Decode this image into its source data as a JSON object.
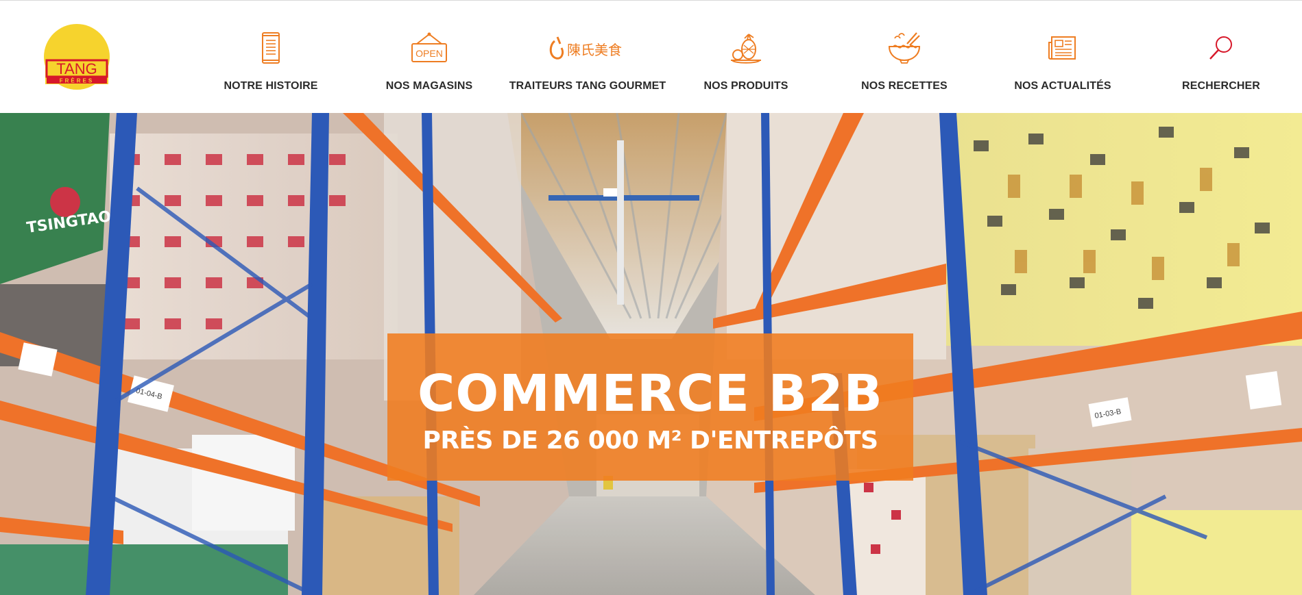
{
  "brand": {
    "logo_text": "TANG",
    "logo_subtext": "FRÈRES",
    "logo_colors": {
      "sun": "#f6d32d",
      "red": "#d7182a"
    }
  },
  "header": {
    "accent_color": "#ee7d22",
    "nav": [
      {
        "label": "NOTRE HISTOIRE",
        "icon": "scroll-icon"
      },
      {
        "label": "NOS MAGASINS",
        "icon": "open-sign-icon"
      },
      {
        "label": "TRAITEURS TANG GOURMET",
        "icon": "tang-gourmet-logo-icon",
        "icon_text": "陳氏美食"
      },
      {
        "label": "NOS PRODUITS",
        "icon": "produce-icon"
      },
      {
        "label": "NOS RECETTES",
        "icon": "noodle-bowl-icon"
      },
      {
        "label": "NOS ACTUALITÉS",
        "icon": "newspaper-icon"
      },
      {
        "label": "RECHERCHER",
        "icon": "search-icon"
      }
    ]
  },
  "hero": {
    "banner_title": "COMMERCE B2B",
    "banner_subtitle": "PRÈS DE 26 000 M² D'ENTREPÔTS",
    "banner_color": "#f07c1f",
    "scene_texts": {
      "left_box_brand": "TSINGTAO",
      "shelf_tag_left": "01-04-B",
      "shelf_tag_right": "01-03-B"
    }
  }
}
